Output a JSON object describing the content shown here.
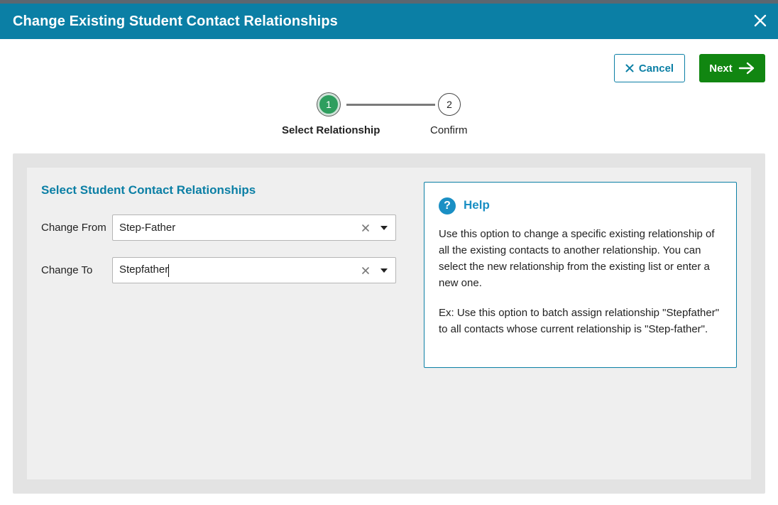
{
  "dialog": {
    "title": "Change Existing Student Contact Relationships"
  },
  "actions": {
    "cancel_label": "Cancel",
    "next_label": "Next"
  },
  "stepper": {
    "steps": [
      {
        "number": "1",
        "label": "Select Relationship",
        "active": true
      },
      {
        "number": "2",
        "label": "Confirm",
        "active": false
      }
    ]
  },
  "form": {
    "section_title": "Select Student Contact Relationships",
    "change_from": {
      "label": "Change From",
      "value": "Step-Father"
    },
    "change_to": {
      "label": "Change To",
      "value": "Stepfather"
    }
  },
  "help": {
    "title": "Help",
    "icon": "question-icon",
    "paragraph1": "Use this option to change a specific existing relationship of all the existing contacts to another relationship. You can select the new relationship from the existing list or enter a new one.",
    "paragraph2": "Ex: Use this option to batch assign relationship \"Stepfather\" to all contacts whose current relationship is \"Step-father\"."
  },
  "colors": {
    "header_bg": "#0b7fa5",
    "accent": "#0b7fa5",
    "next_button": "#118611",
    "active_step": "#2e9e5e",
    "panel_bg": "#efefef"
  }
}
